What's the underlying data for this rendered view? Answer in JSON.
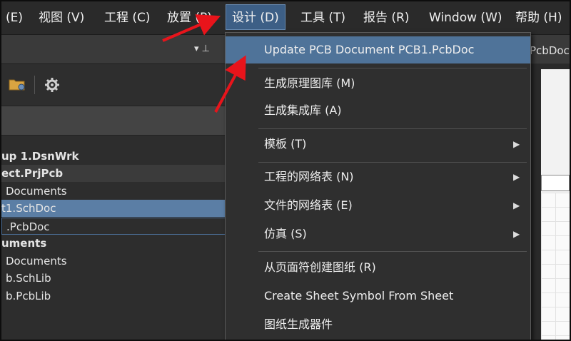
{
  "menubar": {
    "items": [
      {
        "label": "(E)"
      },
      {
        "label": "视图 (V)"
      },
      {
        "label": "工程 (C)"
      },
      {
        "label": "放置 (P)"
      },
      {
        "label": "设计 (D)"
      },
      {
        "label": "工具 (T)"
      },
      {
        "label": "报告 (R)"
      },
      {
        "label": "Window (W)"
      },
      {
        "label": "帮助 (H)"
      }
    ],
    "active_index": 4
  },
  "panel": {
    "pin_glyph": "▾ ⊥",
    "tree": [
      {
        "label": "up 1.DsnWrk",
        "style": "bold"
      },
      {
        "label": "ect.PrjPcb",
        "style": "bold-bar"
      },
      {
        "label": "Documents",
        "style": "normal"
      },
      {
        "label": "t1.SchDoc",
        "style": "selected"
      },
      {
        "label": ".PcbDoc",
        "style": "boxed"
      },
      {
        "label": "uments",
        "style": "bold"
      },
      {
        "label": "Documents",
        "style": "normal"
      },
      {
        "label": "b.SchLib",
        "style": "normal"
      },
      {
        "label": "b.PcbLib",
        "style": "normal"
      }
    ]
  },
  "dropdown": {
    "items": [
      {
        "label": "Update PCB Document PCB1.PcbDoc",
        "submenu": false,
        "highlighted": true
      },
      {
        "label": "生成原理图库 (M)",
        "submenu": false
      },
      {
        "label": "生成集成库 (A)",
        "submenu": false
      },
      {
        "label": "模板 (T)",
        "submenu": true
      },
      {
        "label": "工程的网络表 (N)",
        "submenu": true
      },
      {
        "label": "文件的网络表 (E)",
        "submenu": true
      },
      {
        "label": "仿真 (S)",
        "submenu": true
      },
      {
        "label": "从页面符创建图纸 (R)",
        "submenu": false
      },
      {
        "label": "Create Sheet Symbol From Sheet",
        "submenu": false
      },
      {
        "label": "图纸生成器件",
        "submenu": false
      }
    ],
    "submenu_glyph": "▶"
  },
  "right": {
    "tab_label": "PcbDoc"
  },
  "icons": {
    "folder": "folder-icon",
    "gear": "gear-icon",
    "submenu": "chevron-right-icon"
  },
  "colors": {
    "menu_highlight": "#3d5f86",
    "item_highlight": "#4f7399",
    "selected_row": "#5b7ea5",
    "annotation_arrow": "#e8141b"
  }
}
